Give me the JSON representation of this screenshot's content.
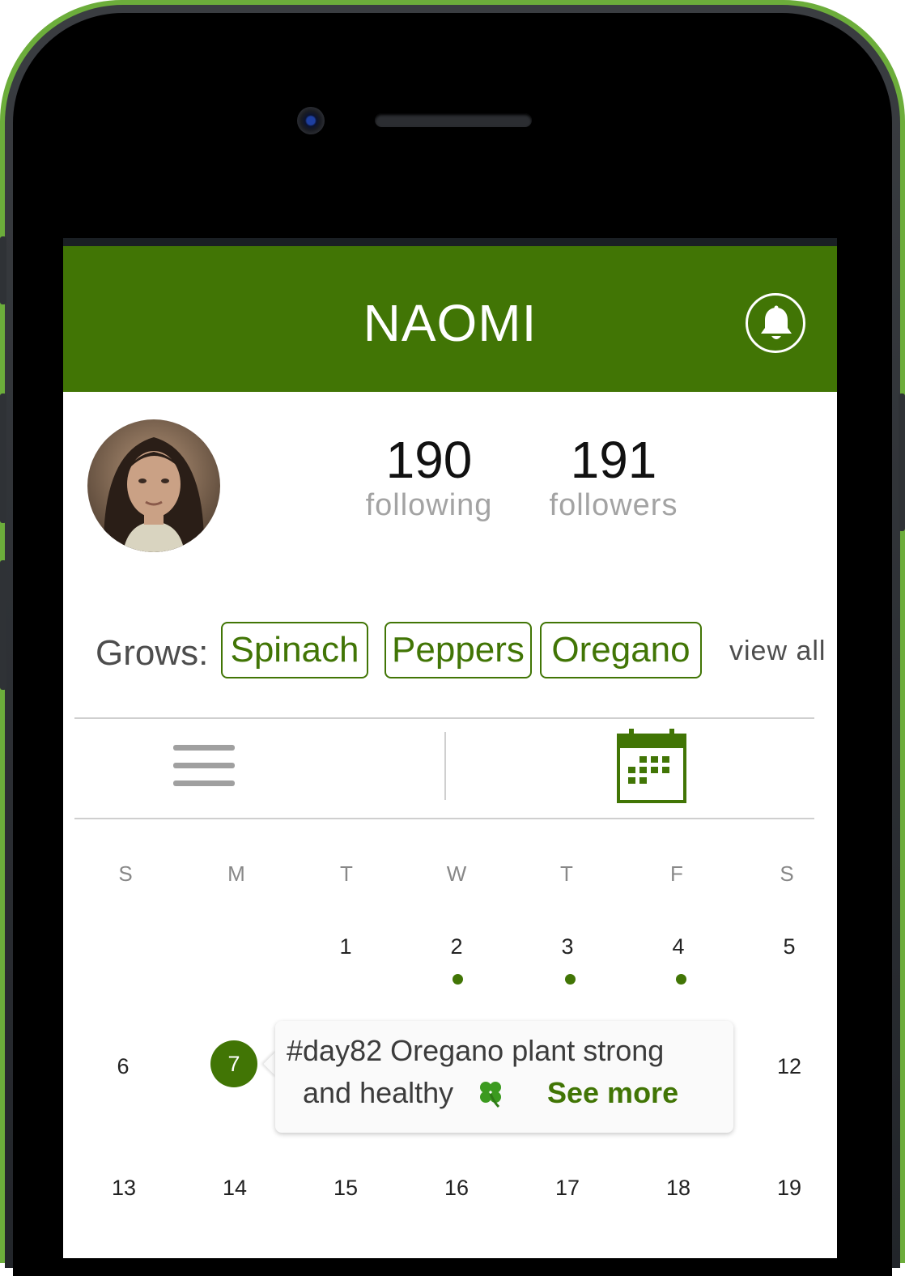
{
  "header": {
    "title": "NAOMI"
  },
  "profile": {
    "following_count": "190",
    "following_label": "following",
    "followers_count": "191",
    "followers_label": "followers"
  },
  "grows": {
    "label": "Grows:",
    "chips": [
      "Spinach",
      "Peppers",
      "Oregano"
    ],
    "view_all": "view all"
  },
  "view_toggle": {
    "active": "calendar"
  },
  "calendar": {
    "weekdays": [
      "S",
      "M",
      "T",
      "W",
      "T",
      "F",
      "S"
    ],
    "rows": [
      [
        "",
        "",
        "1",
        "2",
        "3",
        "4",
        "5"
      ],
      [
        "6",
        "7",
        "",
        "",
        "",
        "",
        "12"
      ],
      [
        "13",
        "14",
        "15",
        "16",
        "17",
        "18",
        "19"
      ]
    ],
    "days_with_posts": [
      "2",
      "3",
      "4"
    ],
    "selected_day": "7"
  },
  "post_preview": {
    "line1": "#day82 Oregano plant strong",
    "line2": "and healthy",
    "emoji": "four-leaf-clover-icon",
    "see_more": "See more"
  },
  "colors": {
    "brand_green": "#417505",
    "phone_frame": "#6cad3b"
  }
}
